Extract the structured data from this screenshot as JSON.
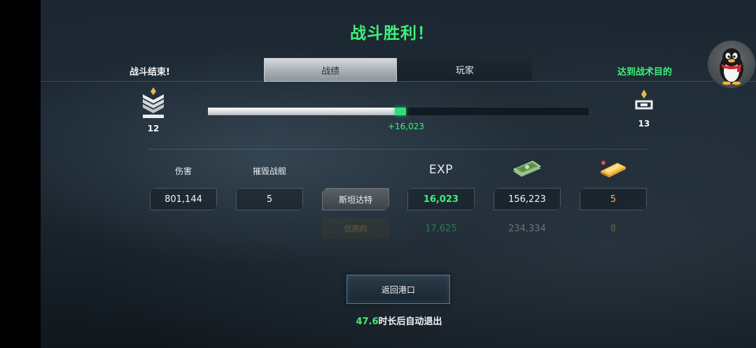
{
  "title": "战斗胜利！",
  "header": {
    "battle_status": "战斗结束!",
    "objective": "达到战术目的",
    "tabs": [
      {
        "label": "战绩",
        "active": true
      },
      {
        "label": "玩家",
        "active": false
      }
    ]
  },
  "rank": {
    "current": "12",
    "next": "13",
    "progress_before": 0.49,
    "progress_after": 0.52,
    "xp_gain": "+16,023"
  },
  "stats": {
    "damage_label": "伤害",
    "destroyed_label": "摧毁战舰",
    "exp_label": "EXP",
    "damage_value": "801,144",
    "destroyed_value": "5",
    "standard_label": "斯坦达特",
    "standard_exp": "16,023",
    "standard_credits": "156,223",
    "standard_gold": "5",
    "premium_label": "优质的",
    "premium_exp": "17,625",
    "premium_credits": "234,334",
    "premium_gold": "8"
  },
  "icons": {
    "credits": "money-stack-icon",
    "gold": "gold-bar-icon",
    "avatar": "qq-penguin-icon"
  },
  "footer": {
    "return_button": "返回港口",
    "countdown_value": "47.6",
    "countdown_text": "时长后自动退出"
  },
  "colors": {
    "accent_green": "#3ef07a",
    "gold": "#f4b73a"
  }
}
